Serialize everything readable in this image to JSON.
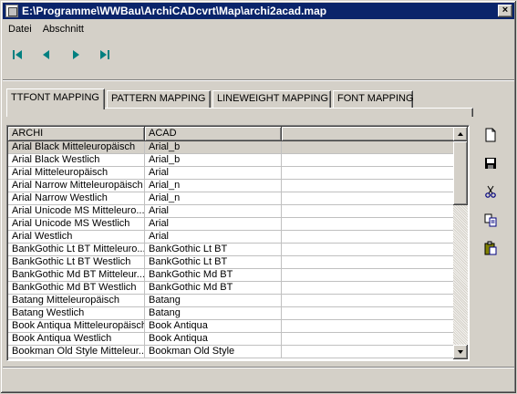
{
  "window": {
    "title": "E:\\Programme\\WWBau\\ArchiCADcvrt\\Map\\archi2acad.map",
    "close_label": "×"
  },
  "menu": {
    "items": [
      "Datei",
      "Abschnitt"
    ]
  },
  "navigation": {
    "buttons": [
      "first-record",
      "previous-record",
      "next-record",
      "last-record"
    ],
    "color": "#008080"
  },
  "tabs": [
    {
      "label": "TTFONT MAPPING",
      "active": true
    },
    {
      "label": "PATTERN MAPPING",
      "active": false
    },
    {
      "label": "LINEWEIGHT MAPPING",
      "active": false
    },
    {
      "label": "FONT MAPPING",
      "active": false
    }
  ],
  "grid": {
    "columns": [
      "ARCHI",
      "ACAD",
      ""
    ],
    "rows": [
      [
        "Arial Black Mitteleuropäisch",
        "Arial_b"
      ],
      [
        "Arial Black Westlich",
        "Arial_b"
      ],
      [
        "Arial Mitteleuropäisch",
        "Arial"
      ],
      [
        "Arial Narrow Mitteleuropäisch",
        "Arial_n"
      ],
      [
        "Arial Narrow Westlich",
        "Arial_n"
      ],
      [
        "Arial Unicode MS Mitteleuro...",
        "Arial"
      ],
      [
        "Arial Unicode MS Westlich",
        "Arial"
      ],
      [
        "Arial Westlich",
        "Arial"
      ],
      [
        "BankGothic Lt BT Mitteleuro...",
        "BankGothic Lt BT"
      ],
      [
        "BankGothic Lt BT Westlich",
        "BankGothic Lt BT"
      ],
      [
        "BankGothic Md BT Mitteleur...",
        "BankGothic Md BT"
      ],
      [
        "BankGothic Md BT Westlich",
        "BankGothic Md BT"
      ],
      [
        "Batang Mitteleuropäisch",
        "Batang"
      ],
      [
        "Batang Westlich",
        "Batang"
      ],
      [
        "Book Antiqua Mitteleuropäisch",
        "Book Antiqua"
      ],
      [
        "Book Antiqua Westlich",
        "Book Antiqua"
      ],
      [
        "Bookman Old Style Mitteleur...",
        "Bookman Old Style"
      ]
    ],
    "selected_row": 0
  },
  "sidebar": {
    "buttons": [
      "new-document-icon",
      "save-icon",
      "cut-icon",
      "copy-icon",
      "paste-icon"
    ]
  }
}
